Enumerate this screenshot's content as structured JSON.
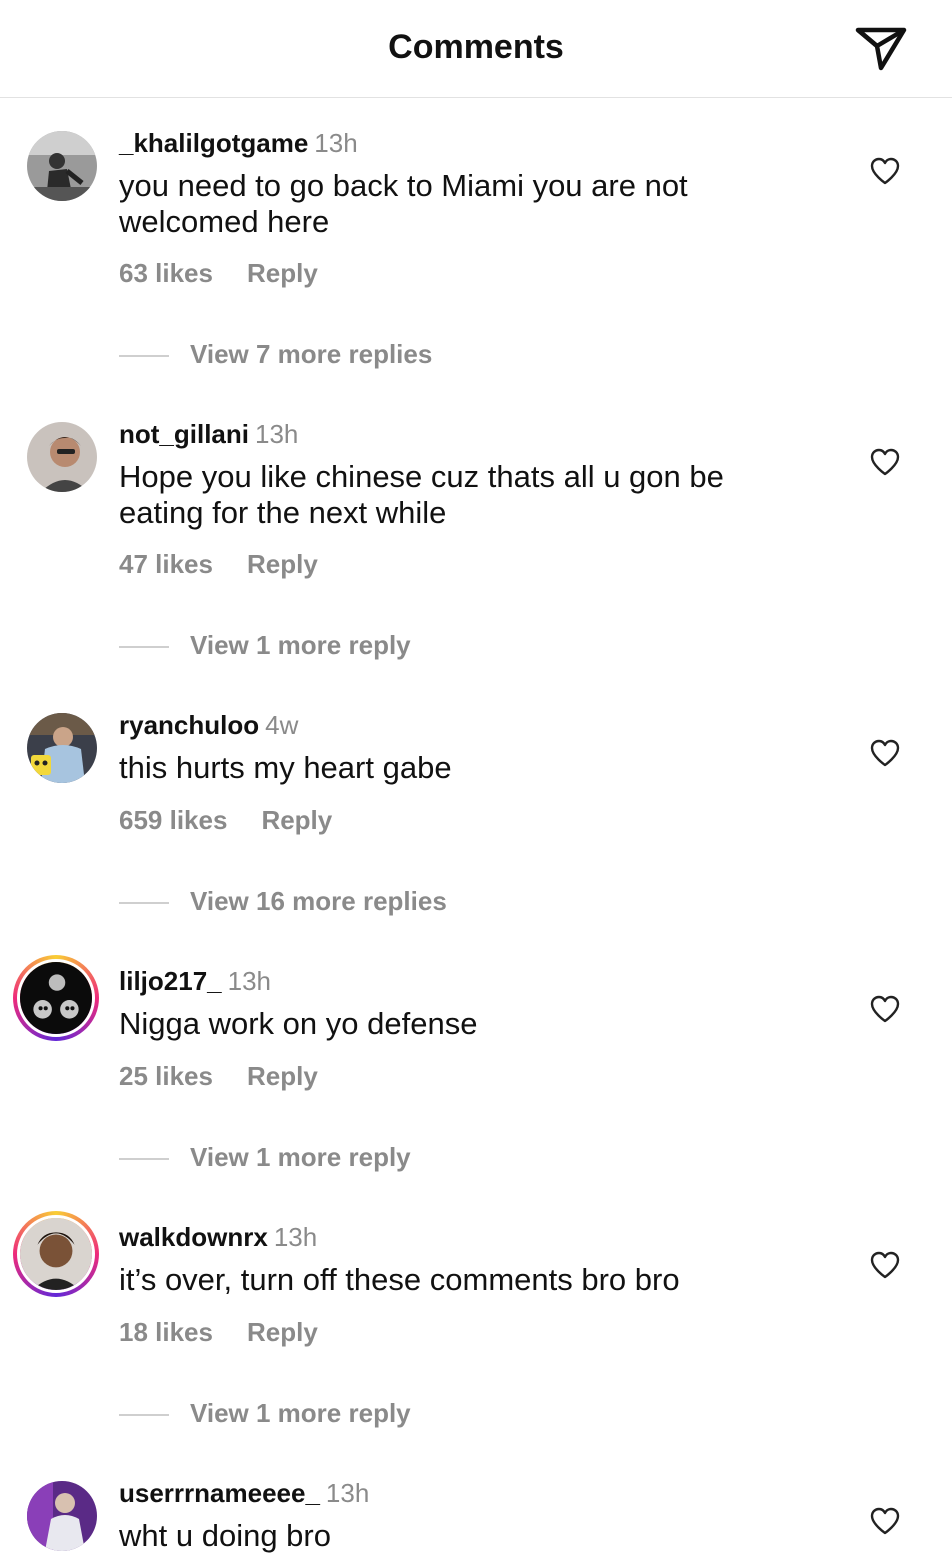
{
  "header": {
    "title": "Comments",
    "send_icon": "paper-plane-icon"
  },
  "comments": [
    {
      "username": "_khalilgotgame",
      "time": "13h",
      "text": "you need to go back to Miami you are not welcomed here",
      "likes": "63 likes",
      "reply": "Reply",
      "view_more": "View 7 more replies",
      "story_ring": false
    },
    {
      "username": "not_gillani",
      "time": "13h",
      "text": "Hope you like chinese cuz thats all u gon be eating for the next while",
      "likes": "47 likes",
      "reply": "Reply",
      "view_more": "View 1 more reply",
      "story_ring": false
    },
    {
      "username": "ryanchuloo",
      "time": "4w",
      "text": "this hurts my heart gabe",
      "likes": "659 likes",
      "reply": "Reply",
      "view_more": "View 16 more replies",
      "story_ring": false
    },
    {
      "username": "liljo217_",
      "time": "13h",
      "text": "Nigga work on yo defense",
      "likes": "25 likes",
      "reply": "Reply",
      "view_more": "View 1 more reply",
      "story_ring": true
    },
    {
      "username": "walkdownrx",
      "time": "13h",
      "text": "it’s over, turn off these comments bro bro",
      "likes": "18 likes",
      "reply": "Reply",
      "view_more": "View 1 more reply",
      "story_ring": true
    },
    {
      "username": "userrrnameeee_",
      "time": "13h",
      "text": "wht u doing bro",
      "story_ring": false
    }
  ],
  "colors": {
    "secondary_text": "#8a8a8a",
    "divider": "#e2e2e2",
    "story_ring": [
      "#f9ce34",
      "#ee2a7b",
      "#6228d7"
    ]
  }
}
